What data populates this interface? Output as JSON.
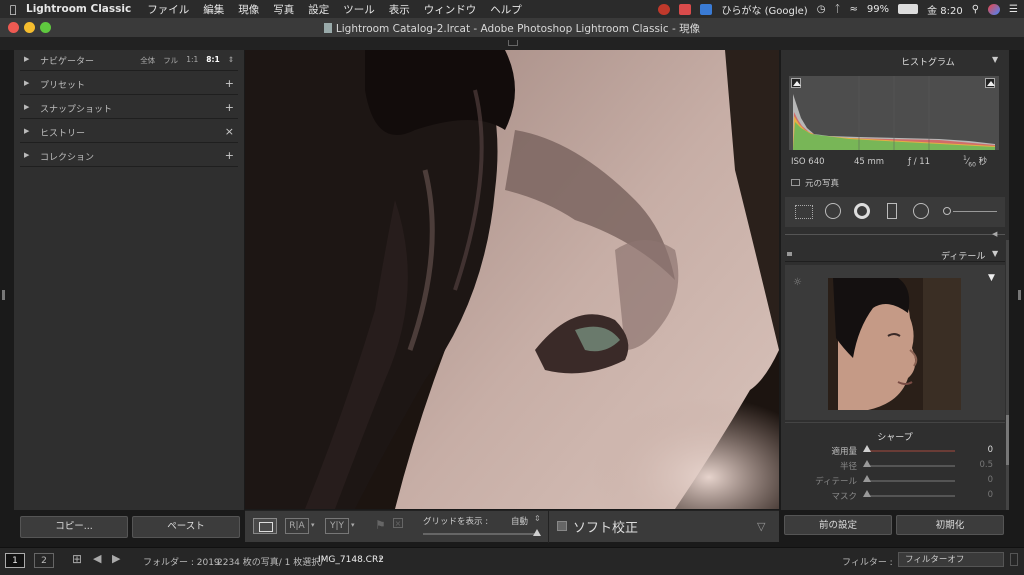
{
  "menubar": {
    "app_name": "Lightroom Classic",
    "items": [
      "ファイル",
      "編集",
      "現像",
      "写真",
      "設定",
      "ツール",
      "表示",
      "ウィンドウ",
      "ヘルプ"
    ],
    "input_source": "ひらがな (Google)",
    "battery": "99%",
    "clock": "金 8:20"
  },
  "window": {
    "title": "Lightroom Catalog-2.lrcat - Adobe Photoshop Lightroom Classic - 現像"
  },
  "left_panel": {
    "navigator": {
      "label": "ナビゲーター",
      "zoom_options": [
        "全体",
        "フル",
        "1:1",
        "8:1"
      ],
      "selected_zoom": "8:1"
    },
    "sections": [
      {
        "label": "プリセット",
        "action": "+"
      },
      {
        "label": "スナップショット",
        "action": "+"
      },
      {
        "label": "ヒストリー",
        "action": "×"
      },
      {
        "label": "コレクション",
        "action": "+"
      }
    ],
    "copy_button": "コピー...",
    "paste_button": "ペースト"
  },
  "toolbar": {
    "grid_label": "グリッドを表示 :",
    "grid_value": "自動",
    "soft_proof_label": "ソフト校正",
    "view_buttons": [
      "R|A",
      "Y|Y"
    ]
  },
  "right_panel": {
    "histogram_title": "ヒストグラム",
    "iso": "ISO 640",
    "focal": "45 mm",
    "aperture": "ƒ / 11",
    "shutter_num": "1",
    "shutter_den": "60",
    "shutter_unit": "秒",
    "original_photo_label": "元の写真",
    "detail_title": "ディテール",
    "sharpen_title": "シャープ",
    "sliders": [
      {
        "label": "適用量",
        "value": "0",
        "fraction": 0.0
      },
      {
        "label": "半径",
        "value": "0.5",
        "fraction": 0.0
      },
      {
        "label": "ディテール",
        "value": "0",
        "fraction": 0.0
      },
      {
        "label": "マスク",
        "value": "0",
        "fraction": 0.0
      }
    ],
    "prev_settings_button": "前の設定",
    "reset_button": "初期化"
  },
  "bottom_bar": {
    "page1": "1",
    "page2": "2",
    "folder_info": "フォルダー : 2019",
    "count_info": "2234 枚の写真/ 1 枚選択/",
    "filename": "IMG_7148.CR2",
    "filter_label": "フィルター :",
    "filter_value": "フィルターオフ"
  },
  "colors": {
    "panel_bg": "#2f2f2f",
    "toolbar_bg": "#3a3a3a",
    "accent_red": "#a0463e"
  }
}
